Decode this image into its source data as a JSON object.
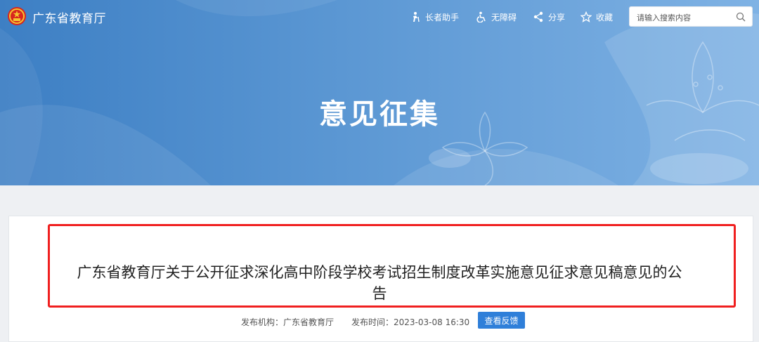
{
  "header": {
    "site_name": "广东省教育厅",
    "tools": {
      "elder": "长者助手",
      "accessible": "无障碍",
      "share": "分享",
      "favorite": "收藏"
    },
    "search": {
      "placeholder": "请输入搜索内容"
    }
  },
  "banner": {
    "title": "意见征集"
  },
  "article": {
    "title": "广东省教育厅关于公开征求深化高中阶段学校考试招生制度改革实施意见征求意见稿意见的公告",
    "publisher_label": "发布机构：",
    "publisher": "广东省教育厅",
    "time_label": "发布时间：",
    "time": "2023-03-08 16:30",
    "feedback_button": "查看反馈"
  },
  "colors": {
    "banner_start": "#3d7fc4",
    "banner_end": "#7fb2e4",
    "highlight": "#f01f1f",
    "button": "#2f7fd9"
  }
}
